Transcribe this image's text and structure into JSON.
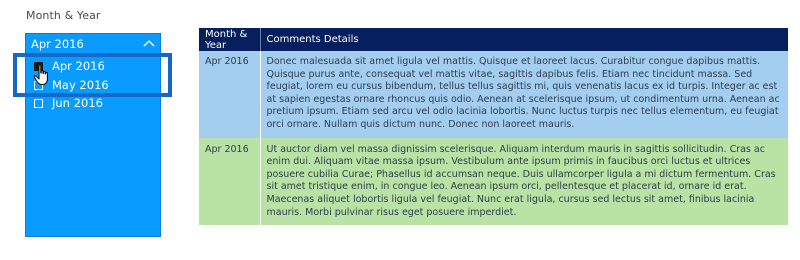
{
  "slicer": {
    "title": "Month & Year",
    "selected_value": "Apr 2016",
    "items": [
      {
        "label": "Apr 2016",
        "checked": true
      },
      {
        "label": "May 2016",
        "checked": false
      },
      {
        "label": "Jun 2016",
        "checked": false
      }
    ]
  },
  "table": {
    "headers": [
      "Month & Year",
      "Comments Details"
    ],
    "rows": [
      {
        "month": "Apr 2016",
        "comment": "Donec malesuada sit amet ligula vel mattis. Quisque et laoreet lacus. Curabitur congue dapibus mattis. Quisque purus ante, consequat vel mattis vitae, sagittis dapibus felis. Etiam nec tincidunt massa. Sed feugiat, lorem eu cursus bibendum, tellus tellus sagittis mi, quis venenatis lacus ex id turpis. Integer ac est at sapien egestas ornare rhoncus quis odio. Aenean at scelerisque ipsum, ut condimentum urna. Aenean ac pretium ipsum. Etiam sed arcu vel odio lacinia lobortis. Nunc luctus turpis nec tellus elementum, eu feugiat orci ornare. Nullam quis dictum nunc. Donec non laoreet mauris."
      },
      {
        "month": "Apr 2016",
        "comment": "Ut auctor diam vel massa dignissim scelerisque. Aliquam interdum mauris in sagittis sollicitudin. Cras ac enim dui. Aliquam vitae massa ipsum. Vestibulum ante ipsum primis in faucibus orci luctus et ultrices posuere cubilia Curae; Phasellus id accumsan neque. Duis ullamcorper ligula a mi dictum fermentum. Cras sit amet tristique enim, in congue leo. Aenean ipsum orci, pellentesque et placerat id, ornare id erat. Maecenas aliquet lobortis ligula vel feugiat. Nunc erat ligula, cursus sed lectus sit amet, finibus lacinia mauris. Morbi pulvinar risus eget posuere imperdiet."
      }
    ]
  },
  "colors": {
    "slicer_background": "#099bff",
    "table_header": "#061f5e",
    "row_blue": "#a3cef0",
    "row_green": "#b9e3a4",
    "highlight_border": "#1668c7"
  },
  "icons": {
    "collapse": "chevron-up-icon",
    "pointer": "hand-cursor-icon"
  }
}
